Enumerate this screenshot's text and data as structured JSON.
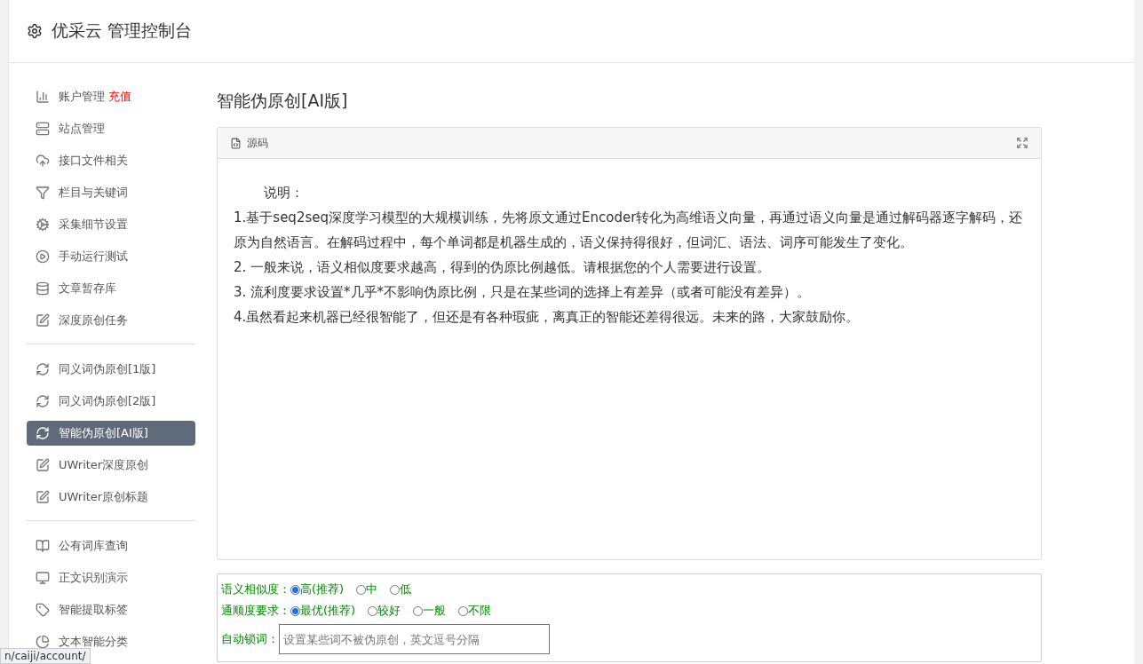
{
  "header": {
    "title": "优采云 管理控制台"
  },
  "sidebar": {
    "groups": [
      {
        "items": [
          {
            "label": "账户管理",
            "badge": "充值",
            "selected": false
          },
          {
            "label": "站点管理",
            "selected": false
          },
          {
            "label": "接口文件相关",
            "selected": false
          },
          {
            "label": "栏目与关键词",
            "selected": false
          },
          {
            "label": "采集细节设置",
            "selected": false
          },
          {
            "label": "手动运行测试",
            "selected": false
          },
          {
            "label": "文章暂存库",
            "selected": false
          },
          {
            "label": "深度原创任务",
            "selected": false
          }
        ]
      },
      {
        "items": [
          {
            "label": "同义词伪原创[1版]",
            "selected": false
          },
          {
            "label": "同义词伪原创[2版]",
            "selected": false
          },
          {
            "label": "智能伪原创[AI版]",
            "selected": true
          },
          {
            "label": "UWriter深度原创",
            "selected": false
          },
          {
            "label": "UWriter原创标题",
            "selected": false
          }
        ]
      },
      {
        "items": [
          {
            "label": "公有词库查询",
            "selected": false
          },
          {
            "label": "正文识别演示",
            "selected": false
          },
          {
            "label": "智能提取标签",
            "selected": false
          },
          {
            "label": "文本智能分类",
            "selected": false
          }
        ]
      }
    ]
  },
  "page": {
    "title": "智能伪原创[AI版]"
  },
  "editor": {
    "toolbar_label": "源码",
    "paragraphs": [
      "说明：",
      "1.基于seq2seq深度学习模型的大规模训练，先将原文通过Encoder转化为高维语义向量，再通过语义向量是通过解码器逐字解码，还原为自然语言。在解码过程中，每个单词都是机器生成的，语义保持得很好，但词汇、语法、词序可能发生了变化。",
      "2. 一般来说，语义相似度要求越高，得到的伪原比例越低。请根据您的个人需要进行设置。",
      "3. 流利度要求设置*几乎*不影响伪原比例，只是在某些词的选择上有差异（或者可能没有差异）。",
      "4.虽然看起来机器已经很智能了，但还是有各种瑕疵，离真正的智能还差得很远。未来的路，大家鼓励你。"
    ]
  },
  "form": {
    "radio_groups": [
      {
        "label": "语义相似度：",
        "options": [
          {
            "label": "高(推荐)",
            "selected": true
          },
          {
            "label": "中",
            "selected": false
          },
          {
            "label": "低",
            "selected": false
          }
        ]
      },
      {
        "label": "通顺度要求：",
        "options": [
          {
            "label": "最优(推荐)",
            "selected": true
          },
          {
            "label": "较好",
            "selected": false
          },
          {
            "label": "一般",
            "selected": false
          },
          {
            "label": "不限",
            "selected": false
          }
        ]
      }
    ],
    "lock_words": {
      "label": "自动锁词：",
      "placeholder": "设置某些词不被伪原创，英文逗号分隔"
    }
  },
  "status_bar": {
    "url": "n/caiji/account/"
  }
}
